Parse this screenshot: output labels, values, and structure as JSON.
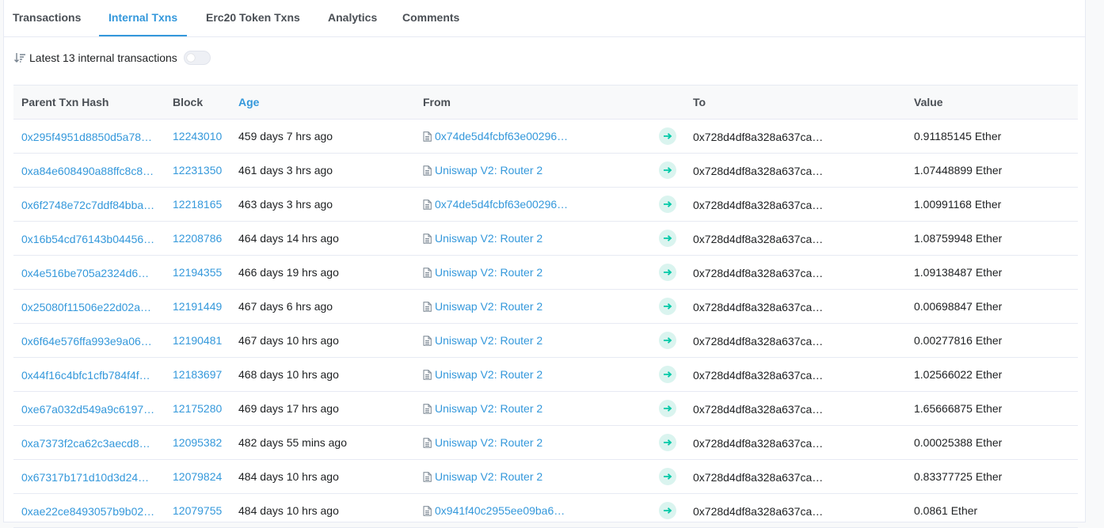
{
  "tabs": [
    {
      "label": "Transactions",
      "active": false
    },
    {
      "label": "Internal Txns",
      "active": true
    },
    {
      "label": "Erc20 Token Txns",
      "active": false
    },
    {
      "label": "Analytics",
      "active": false
    },
    {
      "label": "Comments",
      "active": false
    }
  ],
  "subbar": {
    "label": "Latest 13 internal transactions",
    "toggle_on": false
  },
  "table": {
    "headers": [
      "Parent Txn Hash",
      "Block",
      "Age",
      "From",
      "",
      "To",
      "Value"
    ],
    "rows": [
      {
        "hash": "0x295f4951d8850d5a78…",
        "block": "12243010",
        "age": "459 days 7 hrs ago",
        "from": "0x74de5d4fcbf63e00296…",
        "from_is_contract": true,
        "to": "0x728d4df8a328a637ca…",
        "value": "0.91185145 Ether"
      },
      {
        "hash": "0xa84e608490a88ffc8c8…",
        "block": "12231350",
        "age": "461 days 3 hrs ago",
        "from": "Uniswap V2: Router 2",
        "from_is_contract": true,
        "to": "0x728d4df8a328a637ca…",
        "value": "1.07448899 Ether"
      },
      {
        "hash": "0x6f2748e72c7ddf84bba…",
        "block": "12218165",
        "age": "463 days 3 hrs ago",
        "from": "0x74de5d4fcbf63e00296…",
        "from_is_contract": true,
        "to": "0x728d4df8a328a637ca…",
        "value": "1.00991168 Ether"
      },
      {
        "hash": "0x16b54cd76143b04456…",
        "block": "12208786",
        "age": "464 days 14 hrs ago",
        "from": "Uniswap V2: Router 2",
        "from_is_contract": true,
        "to": "0x728d4df8a328a637ca…",
        "value": "1.08759948 Ether"
      },
      {
        "hash": "0x4e516be705a2324d6…",
        "block": "12194355",
        "age": "466 days 19 hrs ago",
        "from": "Uniswap V2: Router 2",
        "from_is_contract": true,
        "to": "0x728d4df8a328a637ca…",
        "value": "1.09138487 Ether"
      },
      {
        "hash": "0x25080f11506e22d02a…",
        "block": "12191449",
        "age": "467 days 6 hrs ago",
        "from": "Uniswap V2: Router 2",
        "from_is_contract": true,
        "to": "0x728d4df8a328a637ca…",
        "value": "0.00698847 Ether"
      },
      {
        "hash": "0x6f64e576ffa993e9a06…",
        "block": "12190481",
        "age": "467 days 10 hrs ago",
        "from": "Uniswap V2: Router 2",
        "from_is_contract": true,
        "to": "0x728d4df8a328a637ca…",
        "value": "0.00277816 Ether"
      },
      {
        "hash": "0x44f16c4bfc1cfb784f4f…",
        "block": "12183697",
        "age": "468 days 10 hrs ago",
        "from": "Uniswap V2: Router 2",
        "from_is_contract": true,
        "to": "0x728d4df8a328a637ca…",
        "value": "1.02566022 Ether"
      },
      {
        "hash": "0xe67a032d549a9c6197…",
        "block": "12175280",
        "age": "469 days 17 hrs ago",
        "from": "Uniswap V2: Router 2",
        "from_is_contract": true,
        "to": "0x728d4df8a328a637ca…",
        "value": "1.65666875 Ether"
      },
      {
        "hash": "0xa7373f2ca62c3aecd8…",
        "block": "12095382",
        "age": "482 days 55 mins ago",
        "from": "Uniswap V2: Router 2",
        "from_is_contract": true,
        "to": "0x728d4df8a328a637ca…",
        "value": "0.00025388 Ether"
      },
      {
        "hash": "0x67317b171d10d3d24…",
        "block": "12079824",
        "age": "484 days 10 hrs ago",
        "from": "Uniswap V2: Router 2",
        "from_is_contract": true,
        "to": "0x728d4df8a328a637ca…",
        "value": "0.83377725 Ether"
      },
      {
        "hash": "0xae22ce8493057b9b02…",
        "block": "12079755",
        "age": "484 days 10 hrs ago",
        "from": "0x941f40c2955ee09ba6…",
        "from_is_contract": true,
        "to": "0x728d4df8a328a637ca…",
        "value": "0.0861 Ether"
      }
    ]
  },
  "icons": {
    "sort": "sort-descending-icon",
    "contract": "document-icon",
    "direction": "arrow-right-icon"
  },
  "colors": {
    "link": "#3498db",
    "arrow_badge_bg": "#daf4ef",
    "arrow_color": "#00c9a7"
  }
}
